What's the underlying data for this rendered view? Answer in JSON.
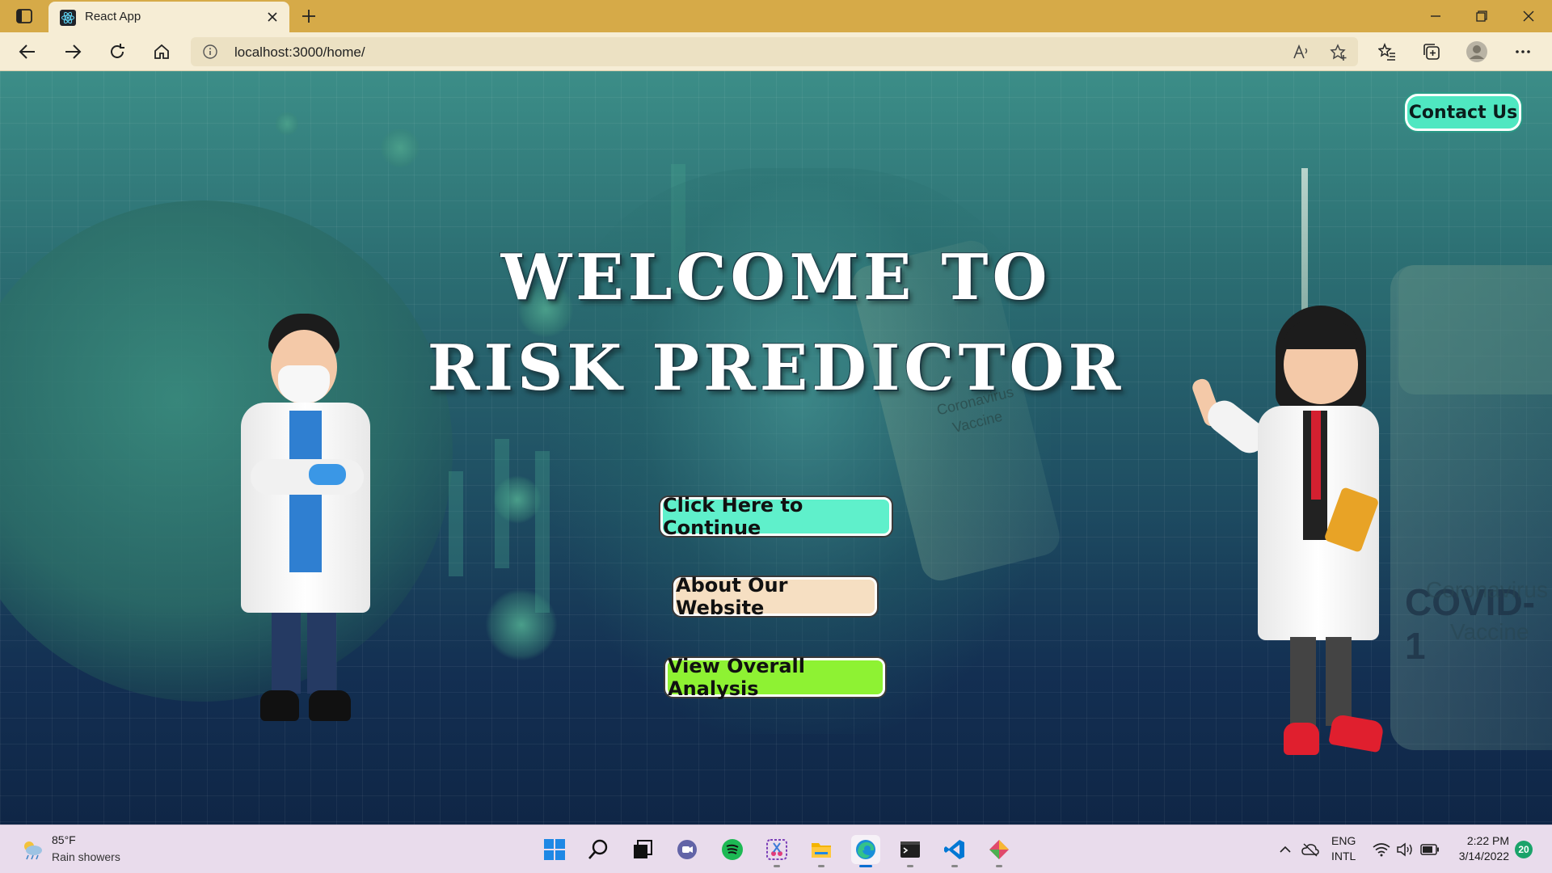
{
  "browser": {
    "tab_title": "React App",
    "url": "localhost:3000/home/"
  },
  "page": {
    "contact_label": "Contact Us",
    "welcome_line1": "WELCOME TO",
    "welcome_line2": "RISK PREDICTOR",
    "buttons": {
      "continue": "Click Here to Continue",
      "about": "About Our Website",
      "analysis": "View Overall Analysis"
    },
    "background_text": {
      "vial_line1": "Coronavirus",
      "vial_line2": "Vaccine",
      "bottle_title": "COVID-1",
      "bottle_line1": "Coronavirus",
      "bottle_line2": "Vaccine"
    }
  },
  "taskbar": {
    "weather_temp": "85°F",
    "weather_desc": "Rain showers",
    "lang_line1": "ENG",
    "lang_line2": "INTL",
    "time": "2:22 PM",
    "date": "3/14/2022",
    "notification_count": "20"
  },
  "colors": {
    "titlebar": "#d6aa48",
    "contact_button": "#4fe7c1",
    "continue_button": "#5ff0cb",
    "about_button": "#f6dfc2",
    "analysis_button": "#8ef233"
  }
}
